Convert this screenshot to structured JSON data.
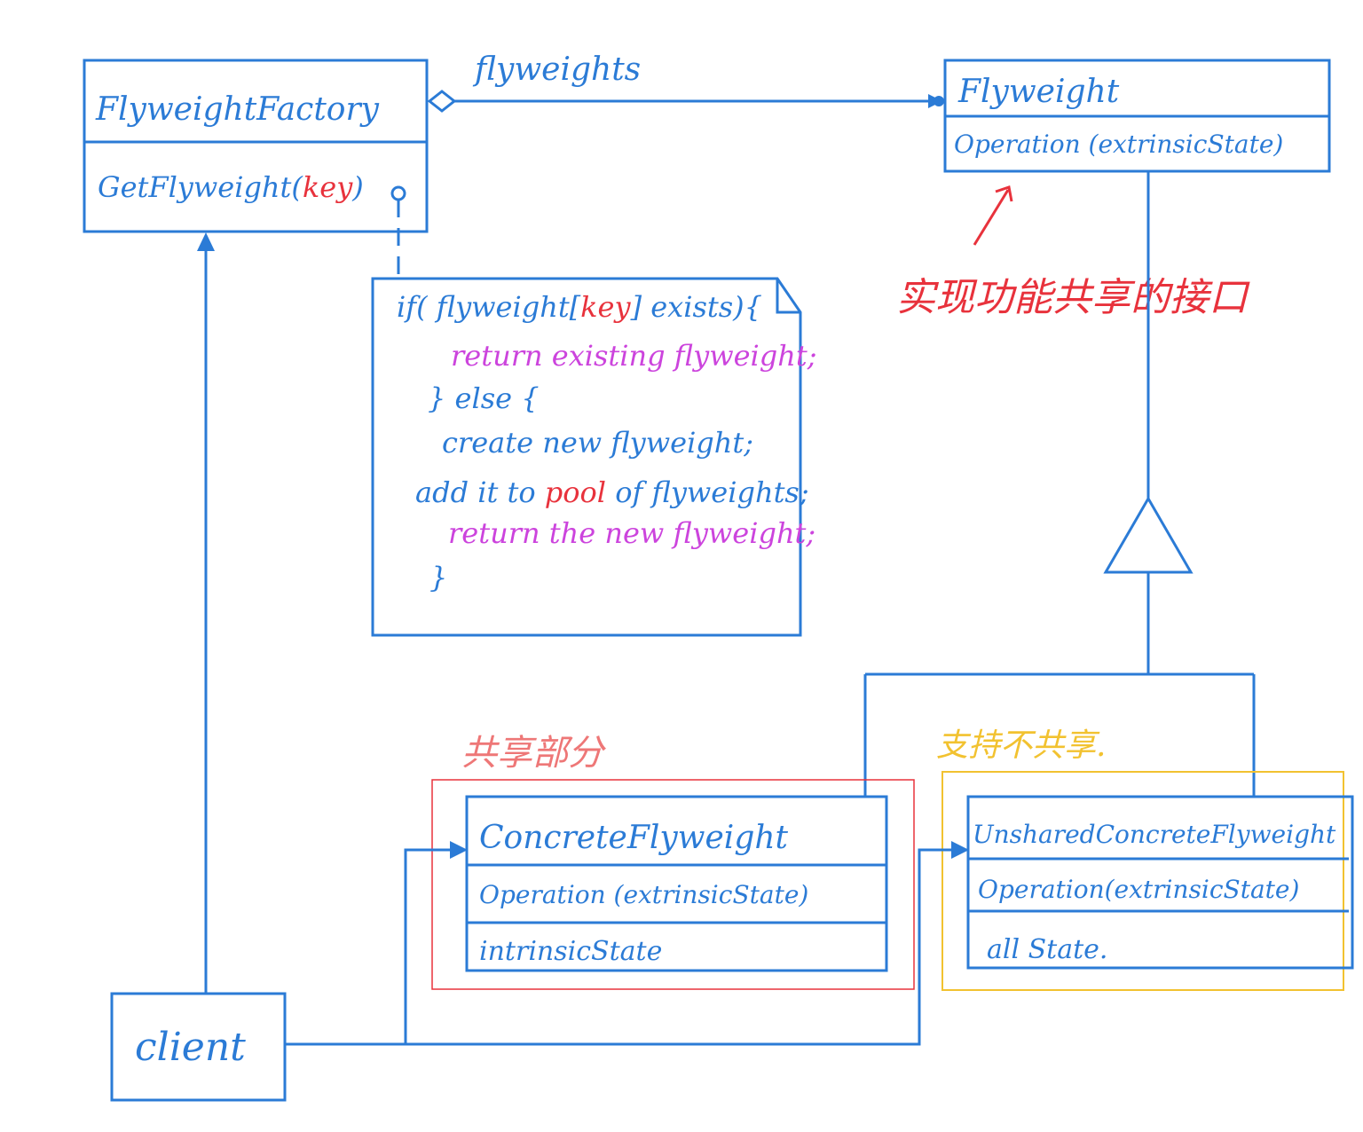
{
  "colors": {
    "line": "#2b7bd6",
    "key": "#e8323c",
    "code_return": "#cc44dd",
    "note_red": "#e8323c",
    "shared_box": "#e8323c",
    "unshared_box": "#f2c230"
  },
  "factory": {
    "name": "FlyweightFactory",
    "method_prefix": "GetFlyweight(",
    "method_key": "key",
    "method_suffix": ")"
  },
  "association_label": "flyweights",
  "flyweight": {
    "name": "Flyweight",
    "operation": "Operation (extrinsicState)"
  },
  "annotation_interface": "实现功能共享的接口",
  "code_note": {
    "line1_prefix": "if( flyweight[",
    "line1_key": "key",
    "line1_suffix": "] exists){",
    "line2": "return existing flyweight;",
    "line3": "} else {",
    "line4": "create new flyweight;",
    "line5_prefix": "add it to ",
    "line5_pool": "pool",
    "line5_suffix": " of flyweights;",
    "line6": "return the new flyweight;",
    "line7": "}"
  },
  "label_shared": "共享部分",
  "label_unshared": "支持不共享.",
  "concrete": {
    "name": "ConcreteFlyweight",
    "operation": "Operation (extrinsicState)",
    "state": "intrinsicState"
  },
  "unshared": {
    "name": "UnsharedConcreteFlyweight",
    "operation": "Operation(extrinsicState)",
    "state": "all State."
  },
  "client": {
    "name": "client"
  }
}
